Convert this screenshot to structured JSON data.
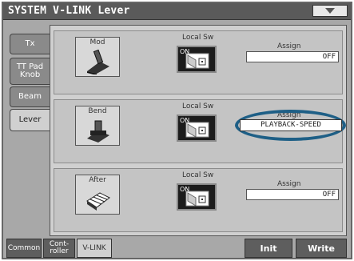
{
  "window": {
    "title": "SYSTEM V-LINK Lever"
  },
  "left_tabs": [
    {
      "label": "Tx",
      "active": false
    },
    {
      "label": "TT Pad Knob",
      "active": false
    },
    {
      "label": "Beam",
      "active": false
    },
    {
      "label": "Lever",
      "active": true
    }
  ],
  "rows": [
    {
      "icon_label": "Mod",
      "icon": "mod-lever-icon",
      "local_sw_label": "Local Sw",
      "local_sw_state": "ON",
      "assign_label": "Assign",
      "assign_value": "OFF",
      "highlighted": false
    },
    {
      "icon_label": "Bend",
      "icon": "bend-lever-icon",
      "local_sw_label": "Local Sw",
      "local_sw_state": "ON",
      "assign_label": "Assign",
      "assign_value": "PLAYBACK-SPEED",
      "highlighted": true
    },
    {
      "icon_label": "After",
      "icon": "aftertouch-keyboard-icon",
      "local_sw_label": "Local Sw",
      "local_sw_state": "ON",
      "assign_label": "Assign",
      "assign_value": "OFF",
      "highlighted": false
    }
  ],
  "bottom_tabs": [
    {
      "label": "Common",
      "active": false
    },
    {
      "label": "Cont-\nroller",
      "active": false
    },
    {
      "label": "V-LINK",
      "active": true
    }
  ],
  "buttons": {
    "init": "Init",
    "write": "Write"
  },
  "colors": {
    "highlight_ring": "#1e5f86"
  }
}
